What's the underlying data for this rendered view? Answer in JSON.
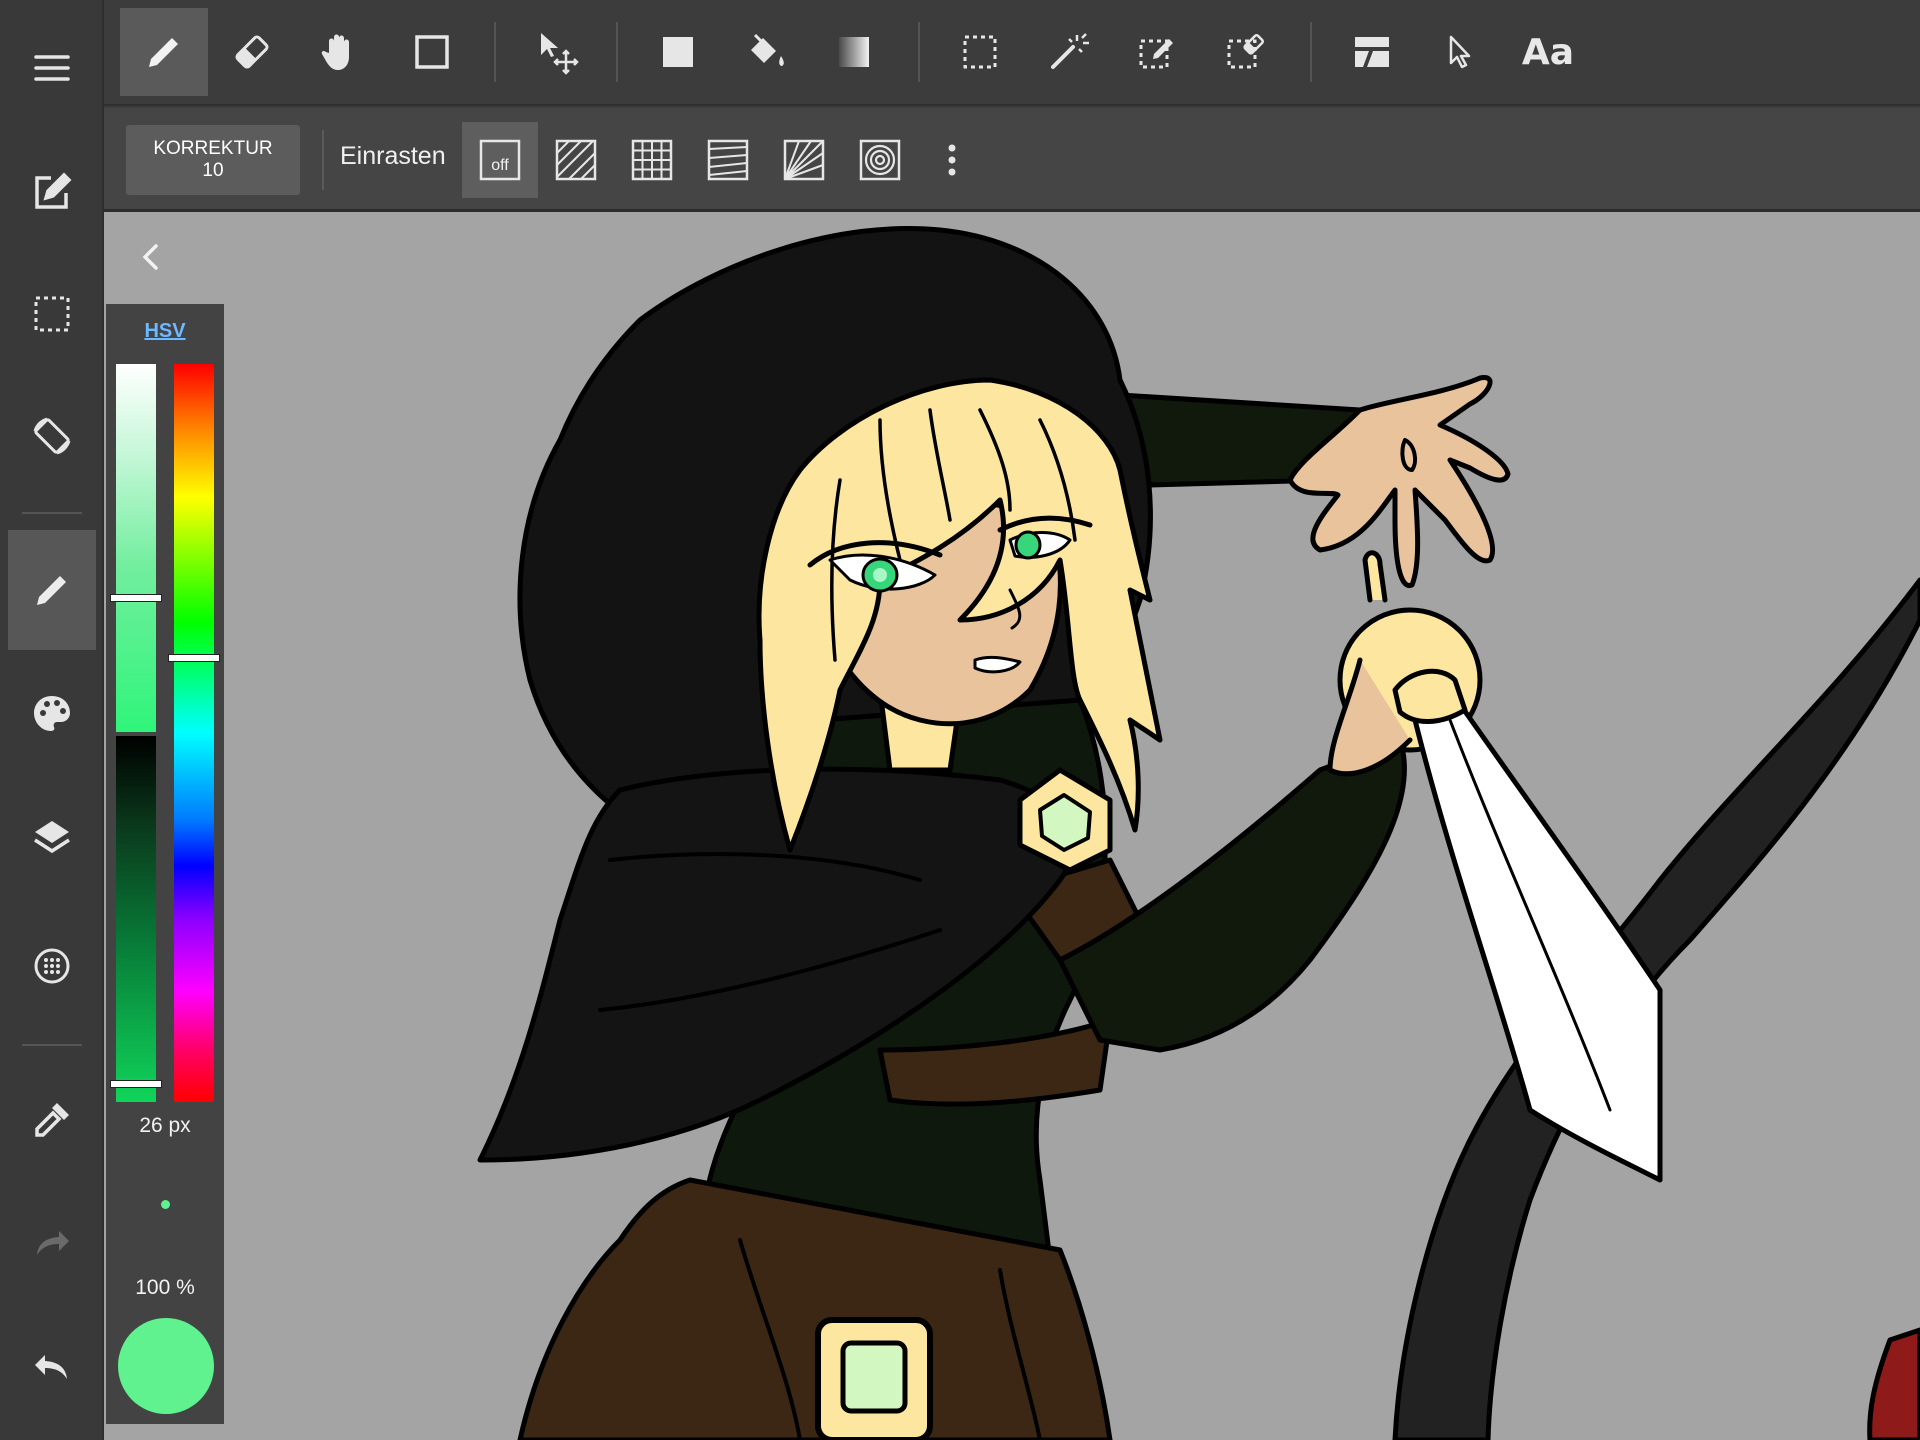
{
  "toolbar": {
    "tools": [
      {
        "name": "pen",
        "icon": "pen-icon",
        "active": true
      },
      {
        "name": "eraser",
        "icon": "eraser-icon"
      },
      {
        "name": "hand",
        "icon": "hand-icon"
      },
      {
        "name": "shape",
        "icon": "square-icon"
      },
      {
        "name": "move",
        "icon": "move-icon"
      },
      {
        "name": "fill-rect",
        "icon": "filled-square-icon"
      },
      {
        "name": "bucket",
        "icon": "bucket-icon"
      },
      {
        "name": "gradient",
        "icon": "gradient-icon"
      },
      {
        "name": "select-rect",
        "icon": "select-rect-icon"
      },
      {
        "name": "magic-wand",
        "icon": "magic-wand-icon"
      },
      {
        "name": "select-pen",
        "icon": "select-pen-icon"
      },
      {
        "name": "select-eraser",
        "icon": "select-eraser-icon"
      },
      {
        "name": "frame",
        "icon": "frame-icon"
      },
      {
        "name": "pointer",
        "icon": "pointer-icon"
      }
    ],
    "text_tool_label": "Aa"
  },
  "subbar": {
    "correction_label": "KORREKTUR",
    "correction_value": "10",
    "snap_label": "Einrasten",
    "snap_off_label": "off"
  },
  "color_panel": {
    "mode": "HSV",
    "brush_size": "26 px",
    "opacity": "100 %",
    "current_color": "#5ff28f"
  },
  "colors": {
    "accent_link": "#6db8ff",
    "canvas_bg": "#a4a4a4"
  }
}
